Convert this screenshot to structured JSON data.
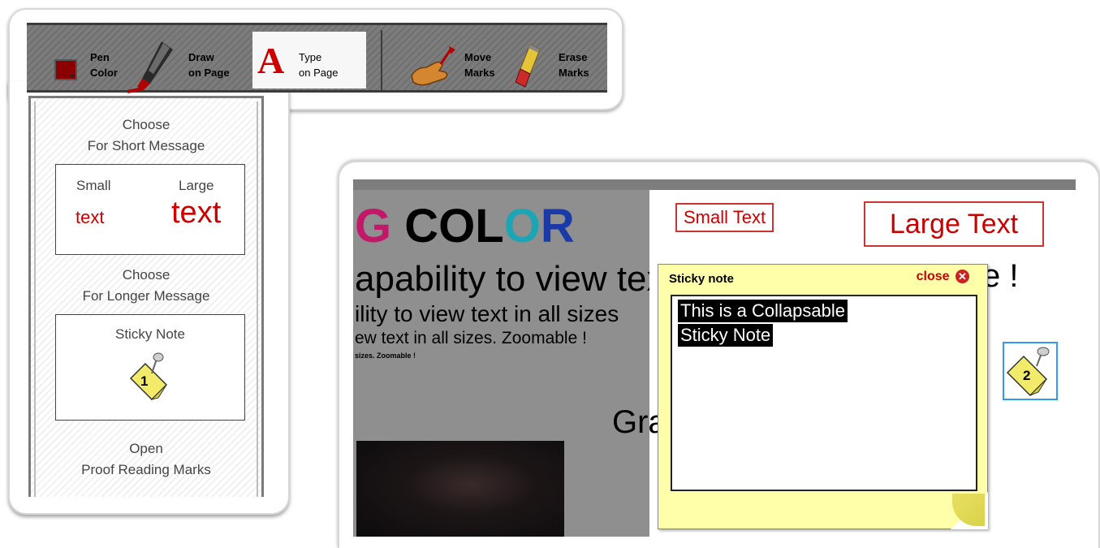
{
  "toolbar": {
    "tools": [
      {
        "line1": "Pen",
        "line2": "Color",
        "icon": "pen-color-swatch"
      },
      {
        "line1": "Draw",
        "line2": "on Page",
        "icon": "marker-icon"
      },
      {
        "line1": "Type",
        "line2": "on Page",
        "icon": "type-a-icon",
        "active": true
      },
      {
        "line1": "Move",
        "line2": "Marks",
        "icon": "hand-icon"
      },
      {
        "line1": "Erase",
        "line2": "Marks",
        "icon": "eraser-icon"
      }
    ],
    "type_glyph": "A",
    "pen_color": "#8b0000"
  },
  "side_panel": {
    "short_heading_1": "Choose",
    "short_heading_2": "For Short Message",
    "small_label": "Small",
    "small_text": "text",
    "large_label": "Large",
    "large_text": "text",
    "long_heading_1": "Choose",
    "long_heading_2": "For Longer Message",
    "sticky_label": "Sticky Note",
    "sticky_number": "1",
    "proof_heading_1": "Open",
    "proof_heading_2": "Proof Reading Marks"
  },
  "page": {
    "title_g": "G",
    "title_col": "COL",
    "title_o": "O",
    "title_r": "R",
    "line1": "apability to view text",
    "line2": "ility to view text in all sizes",
    "line3": "ew text in all sizes. Zoomable !",
    "line4": "sizes. Zoomable !",
    "trailing_excl": "e !",
    "trailing_gra": "Gra"
  },
  "text_tools": {
    "small_button": "Small Text",
    "large_button": "Large Text"
  },
  "sticky_note": {
    "header": "Sticky note",
    "close_label": "close",
    "content_line1": "This is a Collapsable",
    "content_line2": "Sticky Note",
    "collapsed_number": "2"
  },
  "colors": {
    "accent_red": "#cc0000",
    "title_g": "#c2186a",
    "title_o": "#1ea5b5",
    "title_r": "#1a3aa8",
    "sticky_bg": "#ffffaa",
    "selection_blue": "#3399ee"
  }
}
